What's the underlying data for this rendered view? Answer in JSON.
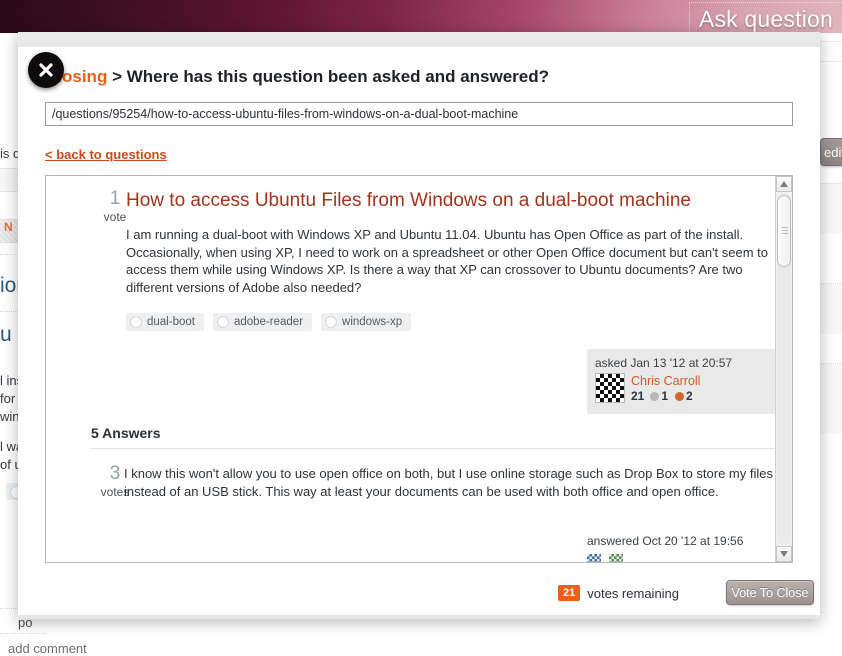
{
  "background": {
    "ask_question_label": "Ask question",
    "edit_button_label": "edit",
    "left_fragments": {
      "frag_is_q": "is q",
      "frag_N": "N",
      "frag_ion": "ion",
      "frag_u_H": "u H",
      "frag_ins": "l ins",
      "frag_for": "for",
      "frag_win": "win",
      "frag_wa": "l wa",
      "frag_of_u": "of u",
      "frag_po": "po",
      "frag_add_comment": "add comment"
    }
  },
  "dialog": {
    "close_icon_label": "x",
    "title_prefix": "Closing",
    "title_rest": "> Where has this question been asked and answered?",
    "url_value": "/questions/95254/how-to-access-ubuntu-files-from-windows-on-a-dual-boot-machine",
    "url_placeholder": "/questions/...",
    "back_link": "< back to questions",
    "question": {
      "vote_count": "1",
      "vote_label": "vote",
      "title": "How to access Ubuntu Files from Windows on a dual-boot machine",
      "body": "I am running a dual-boot with Windows XP and Ubuntu 11.04. Ubuntu has Open Office as part of the install. Occasionally, when using XP, I need to work on a spreadsheet or other Open Office document but can't seem to access them while using Windows XP. Is there a way that XP can crossover to Ubuntu documents? Are two different versions of Adobe also needed?",
      "tags": [
        "dual-boot",
        "adobe-reader",
        "windows-xp"
      ],
      "asked_when": "asked Jan 13 '12 at 20:57",
      "asker_name": "Chris Carroll",
      "asker_reputation": "21",
      "silver_badges": "1",
      "bronze_badges": "2"
    },
    "answers_heading": "5 Answers",
    "answers": [
      {
        "vote_count": "3",
        "vote_label": "votes",
        "body": "I know this won't allow you to use open office on both, but I use online storage such as Drop Box to store my files instead of an USB stick. This way at least your documents can be used with both office and open office.",
        "answered_when": "answered Oct 20 '12 at 19:56"
      }
    ],
    "footer": {
      "votes_remaining_count": "21",
      "votes_remaining_label": "votes remaining",
      "vote_to_close_label": "Vote To Close"
    }
  },
  "colors": {
    "accent_orange": "#e8601c",
    "link_red": "#c94a1a",
    "question_title": "#a5331a",
    "header_dark": "#2c0a18"
  }
}
